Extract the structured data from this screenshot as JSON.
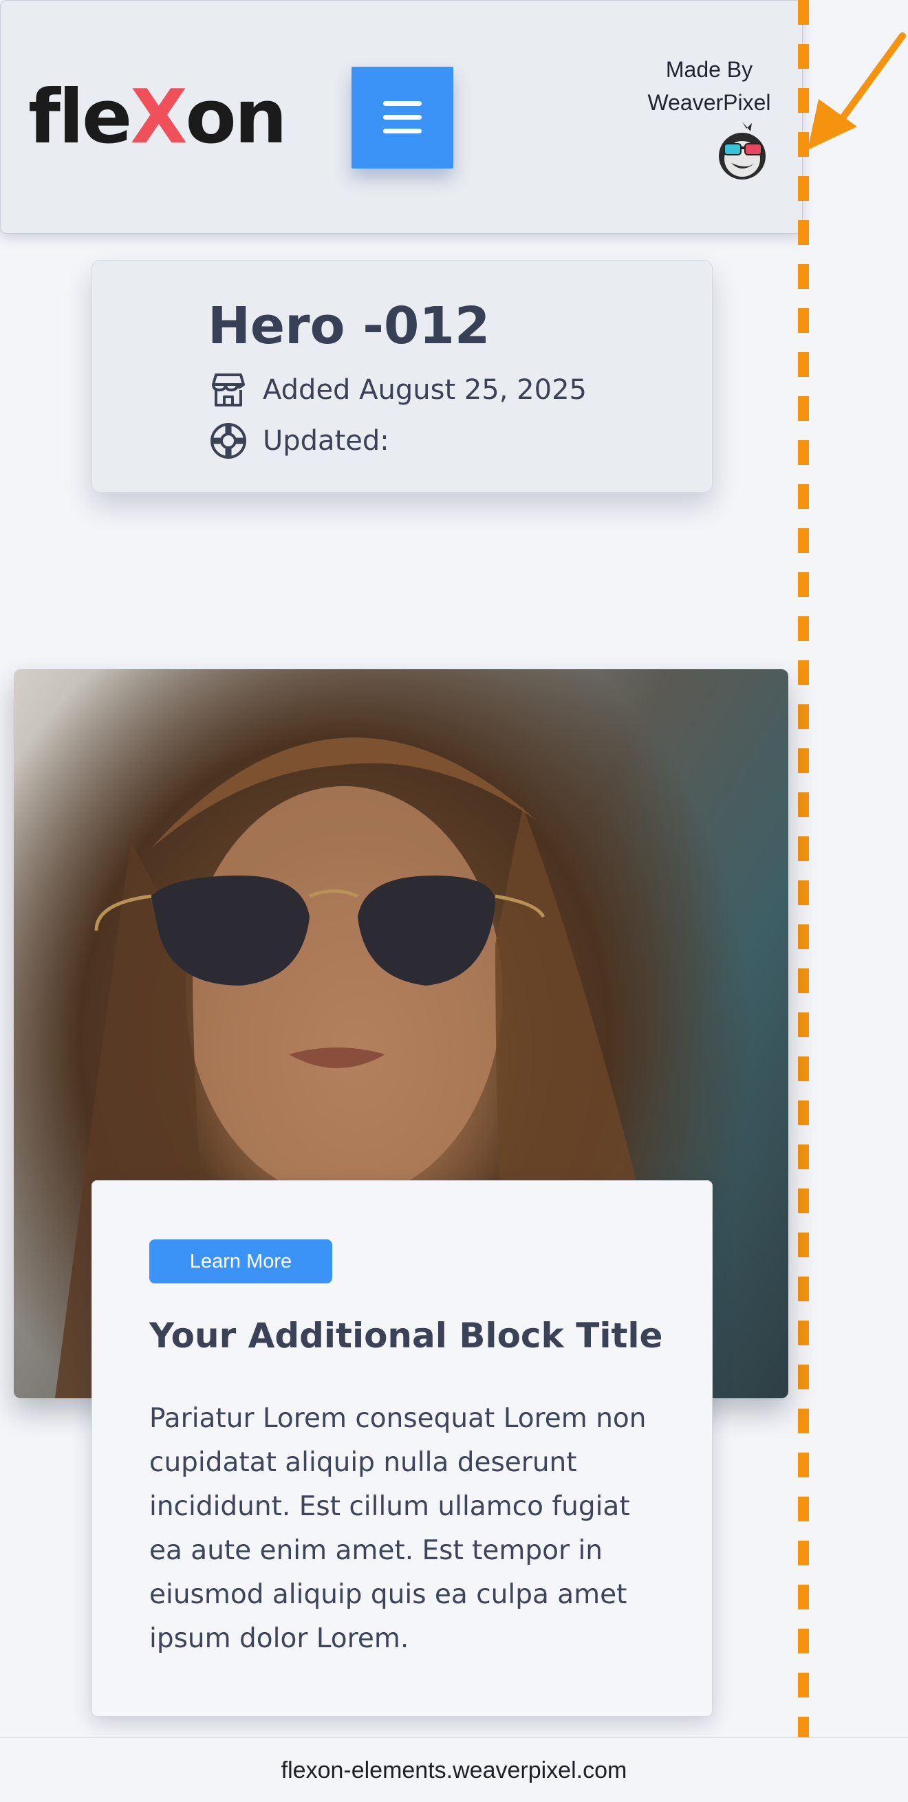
{
  "header": {
    "logo_prefix": "fle",
    "logo_x": "X",
    "logo_suffix": "on",
    "menu_icon": "hamburger-menu-icon",
    "made_by_line1": "Made By",
    "made_by_line2": "WeaverPixel",
    "mascot_icon": "weaverpixel-mascot-icon"
  },
  "info": {
    "title": "Hero -012",
    "added_icon": "store-icon",
    "added": "Added August 25, 2025",
    "updated_icon": "lifebuoy-icon",
    "updated": "Updated:"
  },
  "hero": {
    "image": "woman-with-aviator-sunglasses-photo"
  },
  "card": {
    "button_label": "Learn More",
    "title": "Your Additional Block Title",
    "body": "Pariatur Lorem consequat Lorem non cupidatat aliquip nulla deserunt incididunt. Est cillum ullamco fugiat ea aute enim amet. Est tempor in eiusmod aliquip quis ea culpa amet ipsum dolor Lorem."
  },
  "footer": {
    "url": "flexon-elements.weaverpixel.com"
  },
  "colors": {
    "accent_blue": "#3b93f7",
    "logo_red": "#f0505a",
    "guide_orange": "#f5930f",
    "text_dark": "#3b4256"
  }
}
